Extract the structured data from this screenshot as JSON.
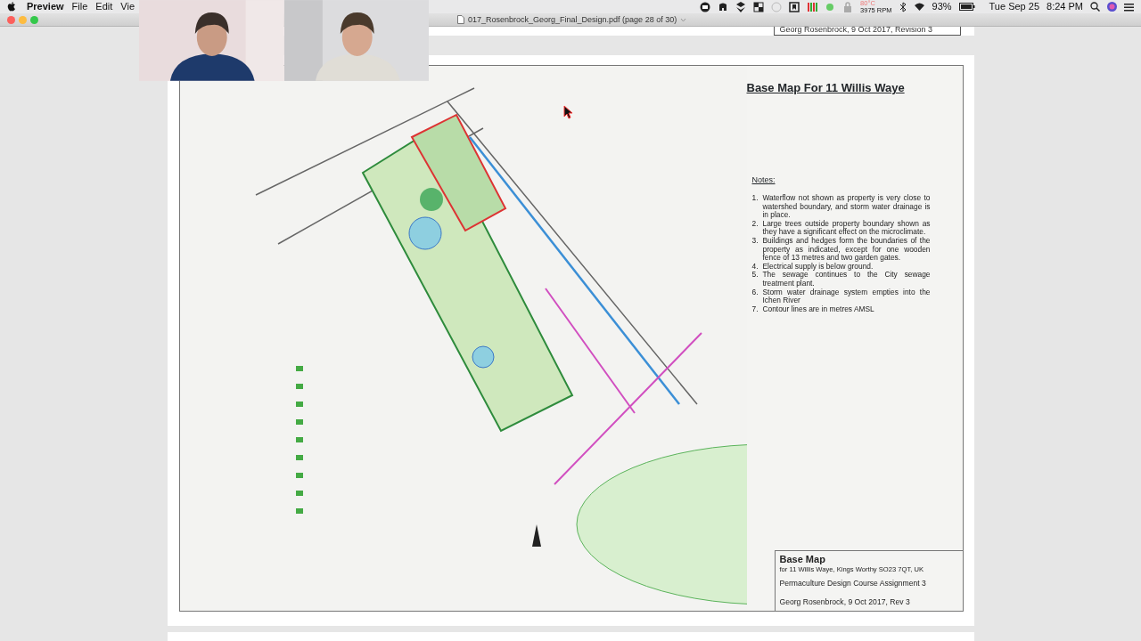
{
  "menu_bar": {
    "app": "Preview",
    "menus": [
      "File",
      "Edit",
      "Vie"
    ],
    "cpu_temp": "80°C",
    "fan_speed": "3975 RPM",
    "battery": "93%",
    "date": "Tue Sep 25",
    "time": "8:24 PM"
  },
  "window": {
    "title": "017_Rosenbrock_Georg_Final_Design.pdf (page 28 of 30)"
  },
  "previous_page": {
    "footer": "Georg Rosenbrock, 9 Oct 2017, Revision 3"
  },
  "page": {
    "title": "Base Map For 11 Willis Waye",
    "notes_heading": "Notes:",
    "notes": [
      {
        "number": "1.",
        "text": "Waterflow not shown as property is very close to watershed boundary, and storm water drainage is in place."
      },
      {
        "number": "2.",
        "text": "Large trees outside property boundary shown as they have a significant effect on the microclimate."
      },
      {
        "number": "3.",
        "text": "Buildings and hedges form the boundaries of the property as indicated, except for one wooden fence of 13 metres and two garden gates."
      },
      {
        "number": "4.",
        "text": "Electrical supply is below ground."
      },
      {
        "number": "5.",
        "text": "The sewage continues to the City sewage treatment plant."
      },
      {
        "number": "6.",
        "text": "Storm water drainage system empties into the Ichen River"
      },
      {
        "number": "7.",
        "text": "Contour lines are in metres AMSL"
      }
    ],
    "title_block": {
      "title": "Base Map",
      "address": "for 11 Willis Waye, Kings Worthy SO23 7QT, UK",
      "course": "Permaculture Design Course Assignment 3",
      "author": "Georg Rosenbrock, 9 Oct 2017, Rev 3"
    }
  }
}
